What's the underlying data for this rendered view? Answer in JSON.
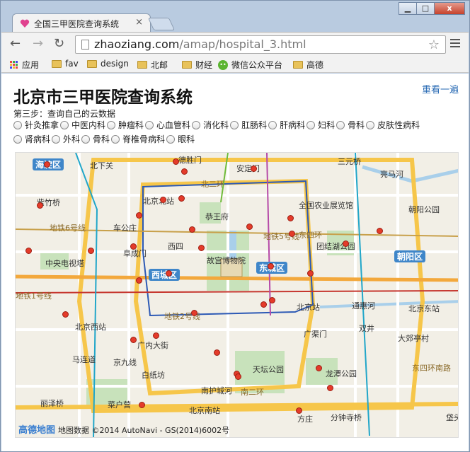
{
  "browser": {
    "tab_title": "全国三甲医院查询系统",
    "tab_close": "×",
    "url_domain": "zhaoziang.com",
    "url_path": "/amap/hospital_3.html",
    "window_controls": {
      "minimize": "▁",
      "maximize": "□",
      "close": "x"
    }
  },
  "bookmarks": [
    {
      "label": "应用",
      "icon": "apps-icon"
    },
    {
      "label": "fav",
      "icon": "folder-icon"
    },
    {
      "label": "design",
      "icon": "folder-icon"
    },
    {
      "label": "北邮",
      "icon": "folder-icon"
    },
    {
      "label": "财经",
      "icon": "folder-icon"
    },
    {
      "label": "微信公众平台",
      "icon": "wechat-icon"
    },
    {
      "label": "高德",
      "icon": "folder-icon"
    }
  ],
  "page": {
    "title": "北京市三甲医院查询系统",
    "reset_link": "重看一遍",
    "step_text": "第三步：查询自己的云数据",
    "departments": [
      "针灸推拿",
      "中医内科",
      "肿瘤科",
      "心血管科",
      "消化科",
      "肛肠科",
      "肝病科",
      "妇科",
      "骨科",
      "皮肤性病科",
      "肾病科",
      "外科",
      "骨科",
      "脊椎骨病科",
      "眼科"
    ]
  },
  "map": {
    "districts": [
      "海淀区",
      "西城区",
      "东城区",
      "朝阳区"
    ],
    "labels": [
      "北下关",
      "德胜门",
      "安定门",
      "三元桥",
      "亮马河",
      "紫竹桥",
      "北京北站",
      "北二环",
      "全国农业展览馆",
      "朝阳公园",
      "恭王府",
      "地铁6号线",
      "车公庄",
      "地铁5号线",
      "东四环",
      "阜成门",
      "西四",
      "团结湖公园",
      "中央电视塔",
      "故宫博物院",
      "地铁1号线",
      "北京站",
      "通惠河",
      "北京东站",
      "地铁2号线",
      "北京西站",
      "双井",
      "广渠门",
      "大郊亭村",
      "广内大街",
      "马连道",
      "京九线",
      "白纸坊",
      "天坛公园",
      "龙潭公园",
      "东四环南路",
      "丽泽桥",
      "菜户营",
      "南护城河",
      "南二环",
      "北京南站",
      "方庄",
      "分钟寺桥",
      "垡头"
    ],
    "footer_brand": "高德地图",
    "footer_text": "地图数据 ©2014 AutoNavi - GS(2014)6002号"
  },
  "colors": {
    "marker": "#e43b2a",
    "district_badge": "#3f86c9",
    "link": "#2a6bb4"
  }
}
